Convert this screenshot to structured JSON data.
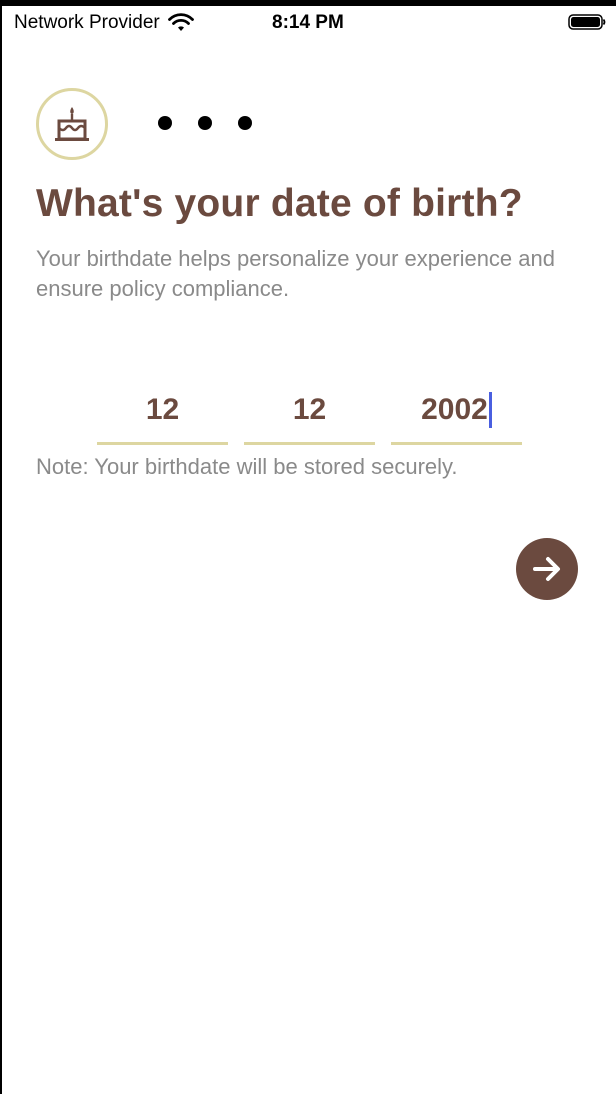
{
  "status_bar": {
    "carrier": "Network Provider",
    "time": "8:14 PM",
    "wifi_icon": "wifi-icon",
    "battery_icon": "battery-full-icon"
  },
  "header": {
    "icon": "birthday-cake-icon",
    "progress_dots": 3
  },
  "title": "What's your date of birth?",
  "subtitle": "Your birthdate helps personalize your experience and ensure policy compliance.",
  "date_inputs": {
    "day": "12",
    "month": "12",
    "year": "2002"
  },
  "note": "Note: Your birthdate will be stored securely.",
  "next_button": {
    "icon": "arrow-right-icon"
  },
  "colors": {
    "brand_brown": "#6b4a3f",
    "accent_khaki": "#ddd6a1",
    "muted_text": "#8a8a8a",
    "caret": "#4a5fe0"
  }
}
